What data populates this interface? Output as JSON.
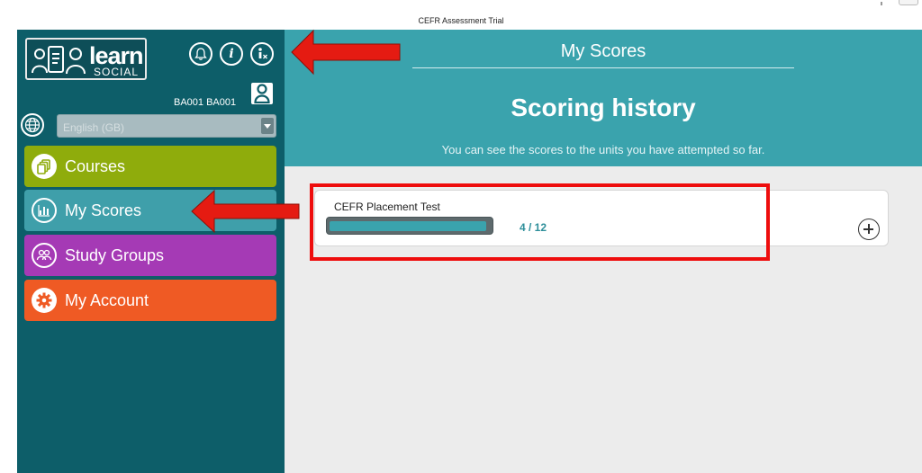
{
  "window": {
    "title": "CEFR Assessment Trial"
  },
  "logo": {
    "word": "learn",
    "sub": "SOCIAL"
  },
  "toolbar": {
    "info_glyph": "i",
    "icons": [
      "bell-icon",
      "info-icon",
      "accessibility-icon"
    ]
  },
  "user": {
    "id_label": "BA001 BA001"
  },
  "language": {
    "selected": "English (GB)"
  },
  "nav": {
    "items": [
      {
        "label": "Courses",
        "icon": "courses-icon",
        "color": "#8fac0c"
      },
      {
        "label": "My Scores",
        "icon": "bar-chart-icon",
        "color": "#3f9faa"
      },
      {
        "label": "Study Groups",
        "icon": "group-icon",
        "color": "#a53ab5"
      },
      {
        "label": "My Account",
        "icon": "gear-icon",
        "color": "#ef5a24"
      }
    ]
  },
  "header": {
    "title": "My Scores",
    "heading": "Scoring history",
    "subtitle": "You can see the scores to the units you have attempted so far."
  },
  "scores": [
    {
      "title": "CEFR Placement Test",
      "score_text": "4 / 12",
      "progress": 0.98
    }
  ],
  "colors": {
    "sidebar": "#0d5e69",
    "header": "#3aa3ad",
    "annotation": "#ee0d0d"
  }
}
